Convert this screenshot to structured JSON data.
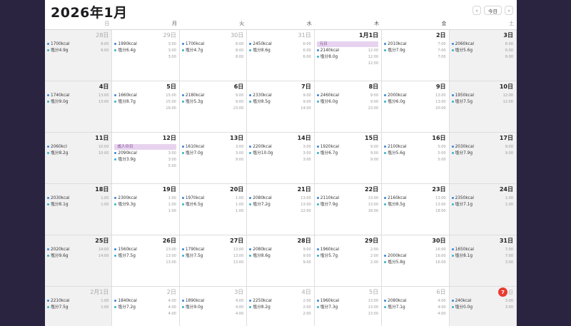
{
  "title": "2026年1月",
  "nav": {
    "prev": "‹",
    "today": "今日",
    "next": "›"
  },
  "colors": {
    "dot_blue": "#3a84d6",
    "dot_teal": "#35b2c9",
    "holiday_bg": "#e7d3ef",
    "today_red": "#ea3b2f",
    "background": "#2a2440"
  },
  "weekdays": [
    "日",
    "月",
    "火",
    "水",
    "木",
    "金",
    "土"
  ],
  "weeks": [
    [
      {
        "label": "28日",
        "other": true,
        "events": [
          {
            "t": "1700kcal",
            "time": "6:00",
            "c": "blue"
          },
          {
            "t": "塩分4.9g",
            "time": "6:00",
            "c": "teal"
          }
        ]
      },
      {
        "label": "29日",
        "other": true,
        "events": [
          {
            "t": "1990kcal",
            "time": "3:00",
            "c": "blue"
          },
          {
            "t": "塩分6.4g",
            "time": "3:00",
            "c": "teal"
          }
        ],
        "extra_times": [
          "3:00"
        ]
      },
      {
        "label": "30日",
        "other": true,
        "events": [
          {
            "t": "1700kcal",
            "time": "8:00",
            "c": "blue"
          },
          {
            "t": "塩分4.7g",
            "time": "8:00",
            "c": "teal"
          }
        ],
        "extra_times": [
          "8:00"
        ]
      },
      {
        "label": "31日",
        "other": true,
        "events": [
          {
            "t": "2450kcal",
            "time": "6:00",
            "c": "blue"
          },
          {
            "t": "塩分8.6g",
            "time": "6:00",
            "c": "teal"
          }
        ],
        "extra_times": [
          "6:00"
        ]
      },
      {
        "label": "1月1日",
        "other": false,
        "holiday": "元日",
        "events": [
          {
            "t": "2140kcal",
            "time": "12:00",
            "c": "blue"
          },
          {
            "t": "塩分8.0g",
            "time": "12:00",
            "c": "teal"
          }
        ],
        "extra_times": [
          "12:00"
        ]
      },
      {
        "label": "2日",
        "other": false,
        "events": [
          {
            "t": "2010kcal",
            "time": "7:00",
            "c": "blue"
          },
          {
            "t": "塩分7.9g",
            "time": "7:00",
            "c": "teal"
          }
        ],
        "extra_times": [
          "7:00"
        ]
      },
      {
        "label": "3日",
        "other": false,
        "events": [
          {
            "t": "2060kcal",
            "time": "6:00",
            "c": "blue"
          },
          {
            "t": "塩分5.6g",
            "time": "6:00",
            "c": "teal"
          }
        ],
        "extra_times": [
          "6:00"
        ]
      }
    ],
    [
      {
        "label": "4日",
        "other": false,
        "events": [
          {
            "t": "1740kcal",
            "time": "13:00",
            "c": "blue"
          },
          {
            "t": "塩分9.0g",
            "time": "13:00",
            "c": "teal"
          }
        ]
      },
      {
        "label": "5日",
        "other": false,
        "events": [
          {
            "t": "1660kcal",
            "time": "15:00",
            "c": "blue"
          },
          {
            "t": "塩分8.7g",
            "time": "15:00",
            "c": "teal"
          }
        ],
        "extra_times": [
          "16:00"
        ]
      },
      {
        "label": "6日",
        "other": false,
        "events": [
          {
            "t": "2180kcal",
            "time": "9:00",
            "c": "blue"
          },
          {
            "t": "塩分5.3g",
            "time": "9:00",
            "c": "teal"
          }
        ],
        "extra_times": [
          "23:00"
        ]
      },
      {
        "label": "7日",
        "other": false,
        "events": [
          {
            "t": "2330kcal",
            "time": "9:00",
            "c": "blue"
          },
          {
            "t": "塩分8.5g",
            "time": "9:00",
            "c": "teal"
          }
        ],
        "extra_times": [
          "14:00"
        ]
      },
      {
        "label": "8日",
        "other": false,
        "events": [
          {
            "t": "2460kcal",
            "time": "9:00",
            "c": "blue"
          },
          {
            "t": "塩分6.0g",
            "time": "9:00",
            "c": "teal"
          }
        ],
        "extra_times": [
          "23:00"
        ]
      },
      {
        "label": "9日",
        "other": false,
        "events": [
          {
            "t": "2000kcal",
            "time": "13:00",
            "c": "blue"
          },
          {
            "t": "塩分6.0g",
            "time": "13:00",
            "c": "teal"
          }
        ],
        "extra_times": [
          "20:00"
        ]
      },
      {
        "label": "10日",
        "other": false,
        "events": [
          {
            "t": "1950kcal",
            "time": "12:00",
            "c": "blue"
          },
          {
            "t": "塩分7.5g",
            "time": "12:00",
            "c": "teal"
          }
        ]
      }
    ],
    [
      {
        "label": "11日",
        "other": false,
        "events": [
          {
            "t": "2060kcl",
            "time": "10:00",
            "c": "blue"
          },
          {
            "t": "塩分8.2g",
            "time": "10:00",
            "c": "teal"
          }
        ]
      },
      {
        "label": "12日",
        "other": false,
        "holiday": "成人の日",
        "events": [
          {
            "t": "2090kcal",
            "time": "3:00",
            "c": "blue"
          },
          {
            "t": "塩分3.9g",
            "time": "3:00",
            "c": "teal"
          }
        ],
        "extra_times": [
          "5:00"
        ]
      },
      {
        "label": "13日",
        "other": false,
        "events": [
          {
            "t": "1610kcal",
            "time": "3:00",
            "c": "blue"
          },
          {
            "t": "塩分7.0g",
            "time": "3:00",
            "c": "teal"
          }
        ],
        "extra_times": [
          "9:00"
        ]
      },
      {
        "label": "14日",
        "other": false,
        "events": [
          {
            "t": "2200kcal",
            "time": "3:00",
            "c": "blue"
          },
          {
            "t": "塩分10.0g",
            "time": "3:00",
            "c": "teal"
          }
        ],
        "extra_times": [
          "3:00"
        ]
      },
      {
        "label": "15日",
        "other": false,
        "events": [
          {
            "t": "1920kcal",
            "time": "9:00",
            "c": "blue"
          },
          {
            "t": "塩分6.7g",
            "time": "9:00",
            "c": "teal"
          }
        ],
        "extra_times": [
          "9:00"
        ]
      },
      {
        "label": "16日",
        "other": false,
        "events": [
          {
            "t": "2100kcal",
            "time": "5:00",
            "c": "blue"
          },
          {
            "t": "塩分5.6g",
            "time": "5:00",
            "c": "teal"
          }
        ],
        "extra_times": [
          "5:00"
        ]
      },
      {
        "label": "17日",
        "other": false,
        "events": [
          {
            "t": "2030kcal",
            "time": "9:00",
            "c": "blue"
          },
          {
            "t": "塩分7.9g",
            "time": "9:00",
            "c": "teal"
          }
        ]
      }
    ],
    [
      {
        "label": "18日",
        "other": false,
        "events": [
          {
            "t": "2030kcal",
            "time": "1:00",
            "c": "blue"
          },
          {
            "t": "塩分8.1g",
            "time": "1:00",
            "c": "teal"
          }
        ]
      },
      {
        "label": "19日",
        "other": false,
        "events": [
          {
            "t": "2300kcal",
            "time": "1:00",
            "c": "blue"
          },
          {
            "t": "塩分9.3g",
            "time": "1:00",
            "c": "teal"
          }
        ],
        "extra_times": [
          "1:00"
        ]
      },
      {
        "label": "20日",
        "other": false,
        "events": [
          {
            "t": "1970kcal",
            "time": "1:00",
            "c": "blue"
          },
          {
            "t": "塩分6.5g",
            "time": "1:00",
            "c": "teal"
          }
        ],
        "extra_times": [
          "1:00"
        ]
      },
      {
        "label": "21日",
        "other": false,
        "events": [
          {
            "t": "2080kcal",
            "time": "13:00",
            "c": "blue"
          },
          {
            "t": "塩分7.2g",
            "time": "13:00",
            "c": "teal"
          }
        ],
        "extra_times": [
          "22:00"
        ]
      },
      {
        "label": "22日",
        "other": false,
        "events": [
          {
            "t": "2110kcal",
            "time": "13:00",
            "c": "blue"
          },
          {
            "t": "塩分7.9g",
            "time": "13:00",
            "c": "teal"
          }
        ],
        "extra_times": [
          "18:00"
        ]
      },
      {
        "label": "23日",
        "other": false,
        "events": [
          {
            "t": "2160kcal",
            "time": "13:00",
            "c": "blue"
          },
          {
            "t": "塩分8.5g",
            "time": "13:00",
            "c": "teal"
          }
        ],
        "extra_times": [
          "18:00"
        ]
      },
      {
        "label": "24日",
        "other": false,
        "events": [
          {
            "t": "2350kcal",
            "time": "1:00",
            "c": "blue"
          },
          {
            "t": "塩分7.1g",
            "time": "1:00",
            "c": "teal"
          }
        ]
      }
    ],
    [
      {
        "label": "25日",
        "other": false,
        "events": [
          {
            "t": "2020kcal",
            "time": "14:00",
            "c": "blue"
          },
          {
            "t": "塩分9.6g",
            "time": "14:00",
            "c": "teal"
          }
        ]
      },
      {
        "label": "26日",
        "other": false,
        "events": [
          {
            "t": "1560kcal",
            "time": "13:00",
            "c": "blue"
          },
          {
            "t": "塩分7.5g",
            "time": "13:00",
            "c": "teal"
          }
        ],
        "extra_times": [
          "13:00"
        ]
      },
      {
        "label": "27日",
        "other": false,
        "events": [
          {
            "t": "1790kcal",
            "time": "13:00",
            "c": "blue"
          },
          {
            "t": "塩分7.5g",
            "time": "13:00",
            "c": "teal"
          }
        ],
        "extra_times": [
          "13:00"
        ]
      },
      {
        "label": "28日",
        "other": false,
        "events": [
          {
            "t": "2080kcal",
            "time": "9:00",
            "c": "blue"
          },
          {
            "t": "塩分8.6g",
            "time": "9:00",
            "c": "teal"
          }
        ],
        "extra_times": [
          "9:00"
        ]
      },
      {
        "label": "29日",
        "other": false,
        "events": [
          {
            "t": "1960kcal",
            "time": "2:00",
            "c": "blue"
          },
          {
            "t": "塩分5.7g",
            "time": "2:00",
            "c": "teal"
          }
        ],
        "extra_times": [
          "2:00"
        ]
      },
      {
        "label": "30日",
        "other": false,
        "lead_times": [
          "16:00"
        ],
        "events": [
          {
            "t": "2000kcal",
            "time": "16:00",
            "c": "blue"
          },
          {
            "t": "塩分5.8g",
            "time": "16:00",
            "c": "teal"
          }
        ]
      },
      {
        "label": "31日",
        "other": false,
        "events": [
          {
            "t": "1650kcal",
            "time": "7:00",
            "c": "blue"
          },
          {
            "t": "塩分8.1g",
            "time": "7:00",
            "c": "teal"
          }
        ],
        "extra_times": [
          "3:00"
        ]
      }
    ],
    [
      {
        "label": "2月1日",
        "other": true,
        "events": [
          {
            "t": "2210kcal",
            "time": "1:00",
            "c": "blue"
          },
          {
            "t": "塩分7.5g",
            "time": "1:00",
            "c": "teal"
          }
        ]
      },
      {
        "label": "2日",
        "other": true,
        "events": [
          {
            "t": "1840kcal",
            "time": "4:00",
            "c": "blue"
          },
          {
            "t": "塩分7.2g",
            "time": "4:00",
            "c": "teal"
          }
        ],
        "extra_times": [
          "4:00"
        ]
      },
      {
        "label": "3日",
        "other": true,
        "events": [
          {
            "t": "1890kcal",
            "time": "4:00",
            "c": "blue"
          },
          {
            "t": "塩分9.0g",
            "time": "4:00",
            "c": "teal"
          }
        ],
        "extra_times": [
          "4:00"
        ]
      },
      {
        "label": "4日",
        "other": true,
        "events": [
          {
            "t": "2250kcal",
            "time": "2:00",
            "c": "blue"
          },
          {
            "t": "塩分8.2g",
            "time": "2:00",
            "c": "teal"
          }
        ],
        "extra_times": [
          "2:00"
        ]
      },
      {
        "label": "5日",
        "other": true,
        "events": [
          {
            "t": "1960kcal",
            "time": "13:00",
            "c": "blue"
          },
          {
            "t": "塩分7.3g",
            "time": "13:00",
            "c": "teal"
          }
        ],
        "extra_times": [
          "13:00"
        ]
      },
      {
        "label": "6日",
        "other": true,
        "events": [
          {
            "t": "2080kcal",
            "time": "4:00",
            "c": "blue"
          },
          {
            "t": "塩分7.1g",
            "time": "4:00",
            "c": "teal"
          }
        ],
        "extra_times": [
          "4:00"
        ]
      },
      {
        "label": "7",
        "today": true,
        "suffix": "日",
        "events": [
          {
            "t": "240kcal",
            "time": "3:00",
            "c": "blue"
          },
          {
            "t": "塩分0.0g",
            "time": "3:00",
            "c": "teal"
          }
        ]
      }
    ]
  ]
}
